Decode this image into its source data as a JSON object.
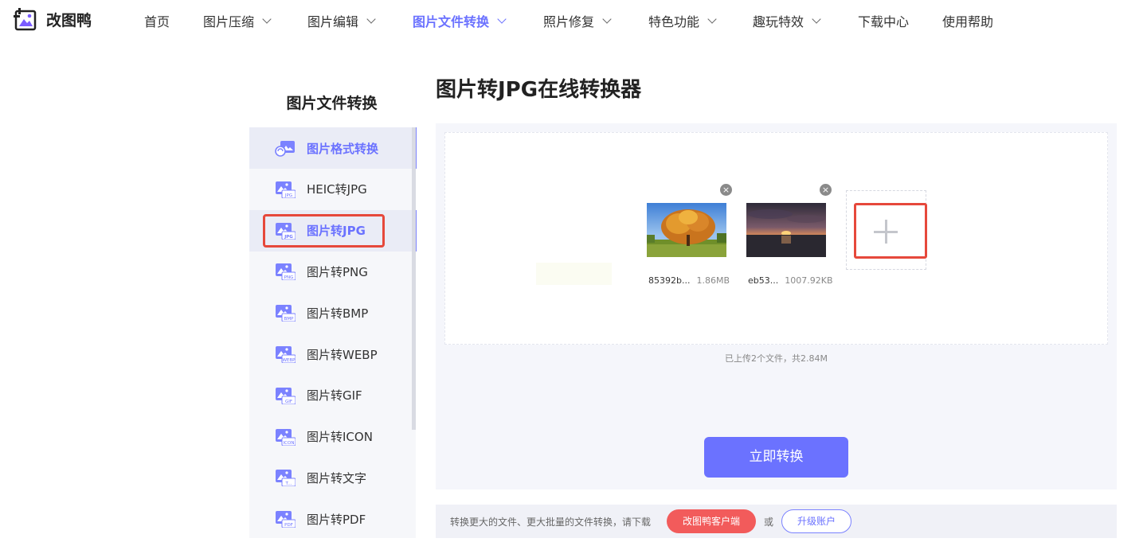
{
  "brand": {
    "name": "改图鸭",
    "accent": "#6b72ff",
    "alert": "#e6483b"
  },
  "nav": [
    {
      "label": "首页",
      "dropdown": false,
      "active": false
    },
    {
      "label": "图片压缩",
      "dropdown": true,
      "active": false
    },
    {
      "label": "图片编辑",
      "dropdown": true,
      "active": false
    },
    {
      "label": "图片文件转换",
      "dropdown": true,
      "active": true
    },
    {
      "label": "照片修复",
      "dropdown": true,
      "active": false
    },
    {
      "label": "特色功能",
      "dropdown": true,
      "active": false
    },
    {
      "label": "趣玩特效",
      "dropdown": true,
      "active": false
    },
    {
      "label": "下载中心",
      "dropdown": false,
      "active": false
    },
    {
      "label": "使用帮助",
      "dropdown": false,
      "active": false
    }
  ],
  "sidebar": {
    "title": "图片文件转换",
    "items": [
      {
        "label": "图片格式转换",
        "badge": "",
        "icon": "image-convert-icon",
        "selected": true
      },
      {
        "label": "HEIC转JPG",
        "badge": "HEIC JPG",
        "icon": "heic-icon",
        "selected": false
      },
      {
        "label": "图片转JPG",
        "badge": "JPG",
        "icon": "jpg-icon",
        "selected": true
      },
      {
        "label": "图片转PNG",
        "badge": "PNG",
        "icon": "png-icon",
        "selected": false
      },
      {
        "label": "图片转BMP",
        "badge": "BMP",
        "icon": "bmp-icon",
        "selected": false
      },
      {
        "label": "图片转WEBP",
        "badge": "WEBP",
        "icon": "webp-icon",
        "selected": false
      },
      {
        "label": "图片转GIF",
        "badge": "GIF",
        "icon": "gif-icon",
        "selected": false
      },
      {
        "label": "图片转ICON",
        "badge": "ICON",
        "icon": "icon-icon",
        "selected": false
      },
      {
        "label": "图片转文字",
        "badge": "T...",
        "icon": "text-icon",
        "selected": false
      },
      {
        "label": "图片转PDF",
        "badge": "PDF",
        "icon": "pdf-icon",
        "selected": false
      }
    ]
  },
  "main": {
    "title": "图片转JPG在线转换器",
    "files": [
      {
        "name": "85392b...",
        "size": "1.86MB"
      },
      {
        "name": "eb53...",
        "size": "1007.92KB"
      }
    ],
    "summary": "已上传2个文件，共2.84M",
    "convert_label": "立即转换"
  },
  "footer": {
    "tip": "转换更大的文件、更大批量的文件转换，请下载",
    "client_label": "改图鸭客户端",
    "or": "或",
    "upgrade_label": "升级账户"
  }
}
